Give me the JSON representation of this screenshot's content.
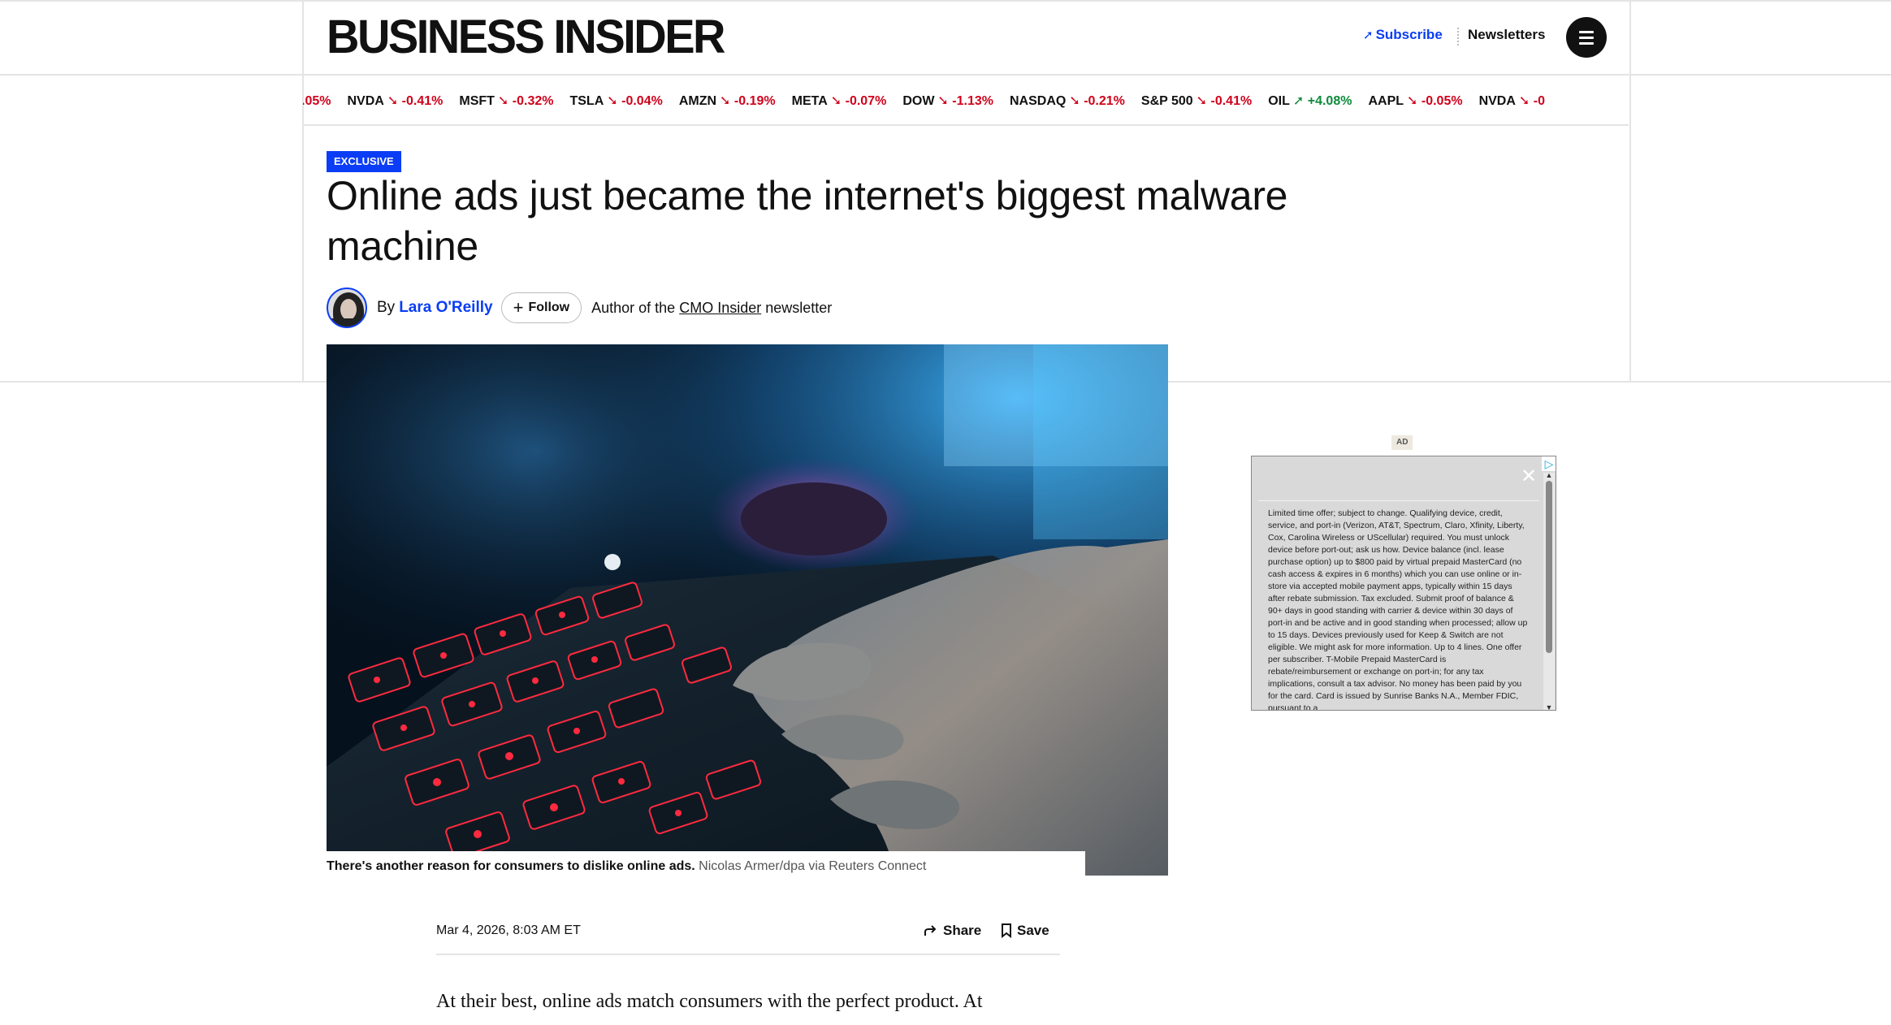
{
  "header": {
    "logo": "BUSINESS INSIDER",
    "subscribe_label": "Subscribe",
    "newsletters_label": "Newsletters",
    "menu_icon": "hamburger-menu-icon"
  },
  "ticker": [
    {
      "sym": "",
      "change": ".05%",
      "dir": "down"
    },
    {
      "sym": "NVDA",
      "change": "-0.41%",
      "dir": "down"
    },
    {
      "sym": "MSFT",
      "change": "-0.32%",
      "dir": "down"
    },
    {
      "sym": "TSLA",
      "change": "-0.04%",
      "dir": "down"
    },
    {
      "sym": "AMZN",
      "change": "-0.19%",
      "dir": "down"
    },
    {
      "sym": "META",
      "change": "-0.07%",
      "dir": "down"
    },
    {
      "sym": "DOW",
      "change": "-1.13%",
      "dir": "down"
    },
    {
      "sym": "NASDAQ",
      "change": "-0.21%",
      "dir": "down"
    },
    {
      "sym": "S&P 500",
      "change": "-0.41%",
      "dir": "down"
    },
    {
      "sym": "OIL",
      "change": "+4.08%",
      "dir": "up"
    },
    {
      "sym": "AAPL",
      "change": "-0.05%",
      "dir": "down"
    },
    {
      "sym": "NVDA",
      "change": "-0",
      "dir": "down"
    }
  ],
  "article": {
    "badge": "EXCLUSIVE",
    "headline": "Online ads just became the internet's biggest malware machine",
    "by": "By",
    "author_name": "Lara O'Reilly",
    "follow_label": "Follow",
    "author_desc_prefix": "Author of the",
    "author_desc_newsletter": "CMO Insider",
    "author_desc_suffix": "newsletter",
    "caption": "There's another reason for consumers to dislike online ads.",
    "credit": "Nicolas Armer/dpa via Reuters Connect",
    "date": "Mar 4, 2026, 8:03 AM ET",
    "share_label": "Share",
    "save_label": "Save",
    "body_first_line": "At their best, online ads match consumers with the perfect product. At"
  },
  "ad": {
    "label": "AD",
    "close_symbol": "✕",
    "choices_symbol": "▷",
    "fine_print": "Limited time offer; subject to change. Qualifying device, credit, service, and port-in (Verizon, AT&T, Spectrum, Claro, Xfinity, Liberty, Cox, Carolina Wireless or UScellular) required. You must unlock device before port-out; ask us how. Device balance (incl. lease purchase option) up to $800 paid by virtual prepaid MasterCard (no cash access & expires in 6 months) which you can use online or in-store via accepted mobile payment apps, typically within 15 days after rebate submission. Tax excluded. Submit proof of balance & 90+ days in good standing with carrier & device within 30 days of port-in and be active and in good standing when processed; allow up to 15 days. Devices previously used for Keep & Switch are not eligible. We might ask for more information. Up to 4 lines. One offer per subscriber. T-Mobile Prepaid MasterCard is rebate/reimbursement or exchange on port-in; for any tax implications, consult a tax advisor. No money has been paid by you for the card. Card is issued by Sunrise Banks N.A., Member FDIC, pursuant to a"
  },
  "colors": {
    "accent_blue": "#0a3df5",
    "ticker_negative": "#d0011b",
    "ticker_positive": "#0d8a3a"
  }
}
